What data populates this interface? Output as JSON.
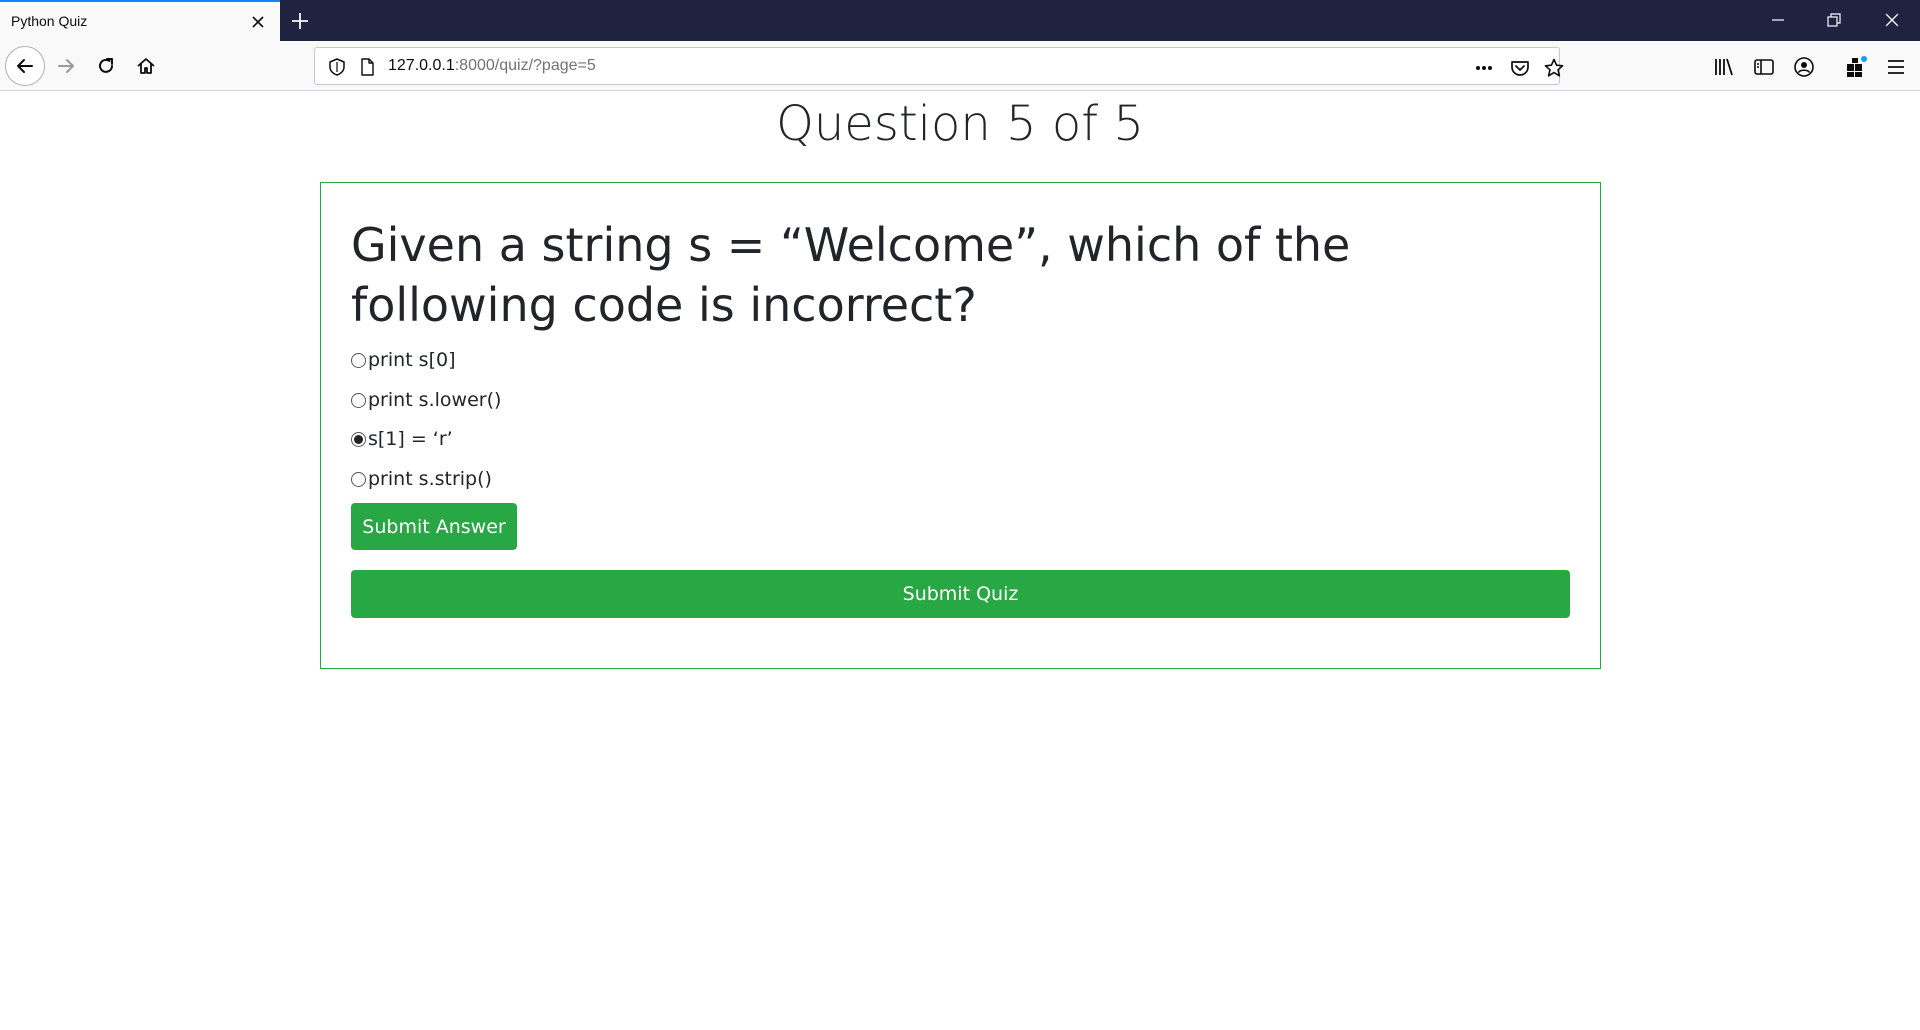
{
  "browser": {
    "tab_title": "Python Quiz",
    "url_host": "127.0.0.1",
    "url_rest": ":8000/quiz/?page=5",
    "accent_color": "#0a84ff",
    "tabbar_color": "#202340"
  },
  "quiz": {
    "heading": "Question 5 of 5",
    "question": "Given a string s = “Welcome”, which of the following code is incorrect?",
    "options": [
      {
        "label": "print s[0]",
        "selected": false
      },
      {
        "label": "print s.lower()",
        "selected": false
      },
      {
        "label": "s[1] = ‘r’",
        "selected": true
      },
      {
        "label": "print s.strip()",
        "selected": false
      }
    ],
    "submit_answer_label": "Submit Answer",
    "submit_quiz_label": "Submit Quiz",
    "accent_color": "#28a745"
  }
}
